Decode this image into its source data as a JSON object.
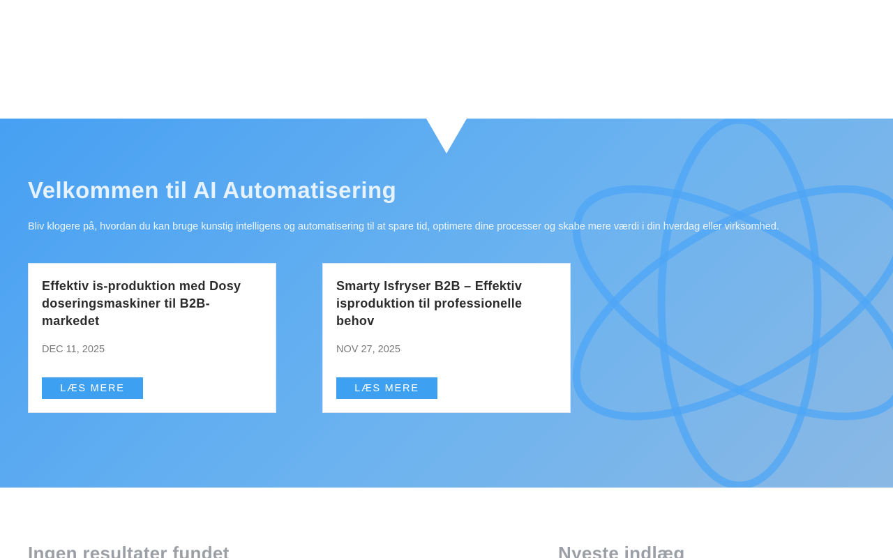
{
  "hero": {
    "title": "Velkommen til AI Automatisering",
    "subtitle": "Bliv klogere på, hvordan du kan bruge kunstig intelligens og automatisering til at spare tid, optimere dine processer og skabe mere værdi i din hverdag eller virksomhed.",
    "background_from": "#47a0f2",
    "background_to": "#8ab8e4",
    "decoration_icon": "atom-icon"
  },
  "posts": [
    {
      "title": "Effektiv is-produktion med Dosy doseringsmaskiner til B2B-markedet",
      "date": "DEC 11, 2025",
      "button": "LÆS MERE"
    },
    {
      "title": "Smarty Isfryser B2B – Effektiv isproduktion til professionelle behov",
      "date": "NOV 27, 2025",
      "button": "LÆS MERE"
    }
  ],
  "sections": {
    "no_results": "Ingen resultater fundet",
    "latest_posts": "Nyeste indlæg"
  },
  "colors": {
    "button": "#3ea0f0",
    "heading_gray": "#9b9fa6"
  }
}
